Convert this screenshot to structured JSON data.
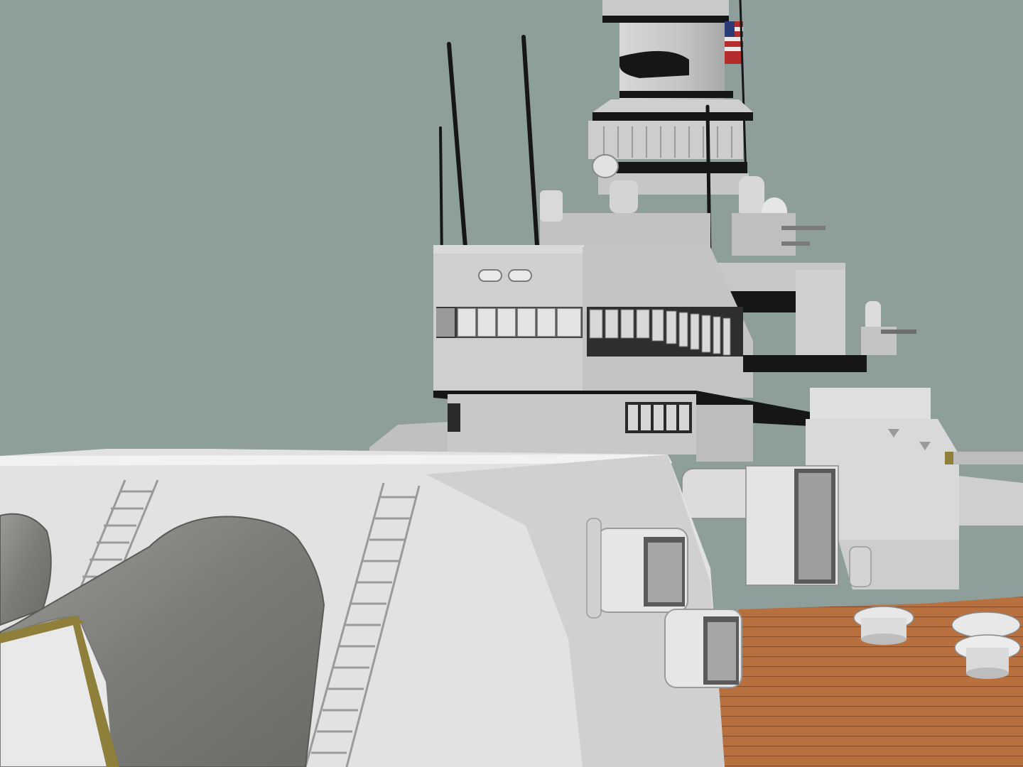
{
  "scene": {
    "subject": "battleship-3d-render",
    "colors": {
      "sky": "#8e9e9b",
      "hull_light": "#e4e4e4",
      "hull_mid": "#c8c8c8",
      "hull_dark": "#9a9a9a",
      "black": "#161616",
      "deck": "#b8703e",
      "deck_line": "#8a4f28",
      "barrel": "#7f7f7b",
      "brass": "#8e7f3a",
      "window": "#ececec",
      "window_dark": "#3a3a3a"
    }
  }
}
